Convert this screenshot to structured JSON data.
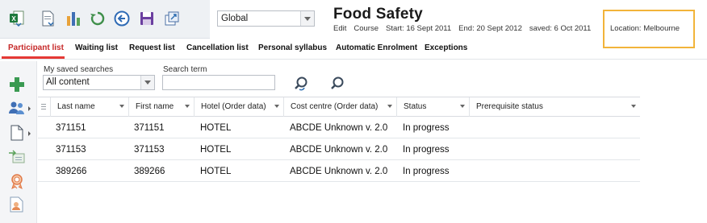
{
  "toolbar": {
    "buttons": [
      {
        "name": "export-excel-icon"
      },
      {
        "name": "export-document-icon"
      },
      {
        "name": "bar-chart-icon"
      },
      {
        "name": "refresh-icon"
      },
      {
        "name": "back-arrow-icon"
      },
      {
        "name": "save-icon"
      },
      {
        "name": "open-window-icon"
      }
    ],
    "scope_select": {
      "value": "Global"
    }
  },
  "course": {
    "title": "Food Safety",
    "meta": {
      "edit": "Edit",
      "course": "Course",
      "start": "Start: 16 Sept 2011",
      "end": "End: 20 Sept 2012",
      "saved": "saved: 6 Oct 2011",
      "location": "Location: Melbourne"
    },
    "location_highlight_color": "#f2b43a"
  },
  "tabs": [
    {
      "label": "Participant list",
      "active": true
    },
    {
      "label": "Waiting list",
      "active": false
    },
    {
      "label": "Request list",
      "active": false
    },
    {
      "label": "Cancellation list",
      "active": false
    },
    {
      "label": "Personal syllabus",
      "active": false
    },
    {
      "label": "Automatic Enrolment",
      "active": false
    },
    {
      "label": "Exceptions",
      "active": false
    }
  ],
  "accent_color": "#e53935",
  "sidebar": [
    {
      "name": "add-participant-icon"
    },
    {
      "name": "users-group-icon"
    },
    {
      "name": "document-menu-icon"
    },
    {
      "name": "move-participant-icon"
    },
    {
      "name": "award-icon"
    },
    {
      "name": "certificate-user-icon"
    }
  ],
  "search": {
    "saved_label": "My saved searches",
    "saved_value": "All content",
    "term_label": "Search term",
    "term_value": ""
  },
  "grid": {
    "columns": [
      "Last name",
      "First name",
      "Hotel (Order data)",
      "Cost centre (Order data)",
      "Status",
      "Prerequisite status"
    ],
    "rows": [
      [
        "371151",
        "371151",
        "HOTEL",
        "ABCDE Unknown v. 2.0",
        "In progress",
        ""
      ],
      [
        "371153",
        "371153",
        "HOTEL",
        "ABCDE Unknown v. 2.0",
        "In progress",
        ""
      ],
      [
        "389266",
        "389266",
        "HOTEL",
        "ABCDE Unknown v. 2.0",
        "In progress",
        ""
      ]
    ]
  }
}
